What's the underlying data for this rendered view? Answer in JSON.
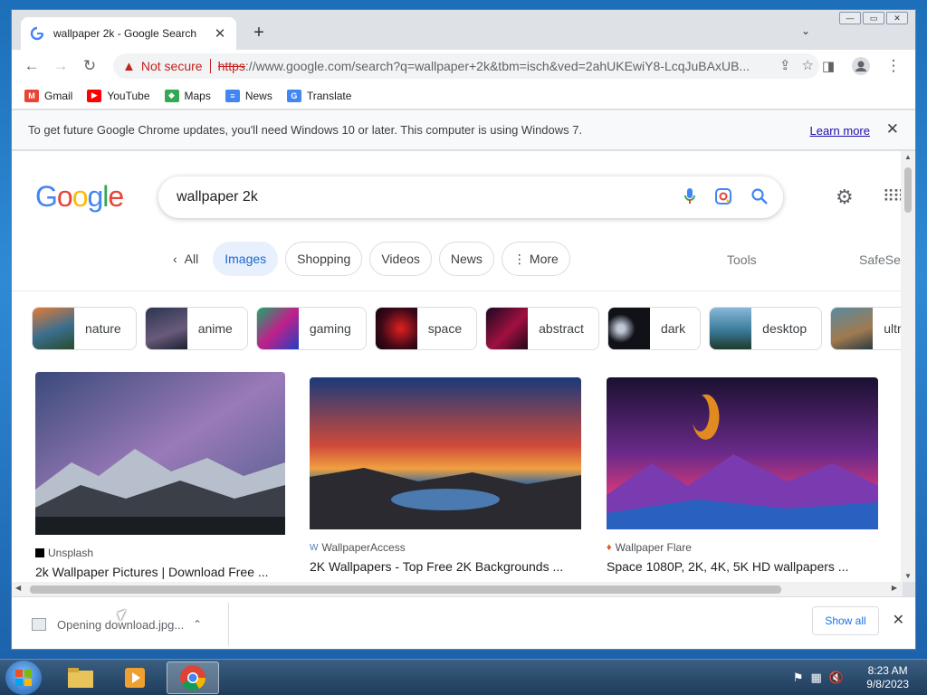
{
  "browser": {
    "tab_title": "wallpaper 2k - Google Search",
    "new_tab": "+",
    "not_secure": "Not secure",
    "url_scheme": "https",
    "url_rest": "://www.google.com/search?q=wallpaper+2k&tbm=isch&ved=2ahUKEwiY8-LcqJuBAxUB..."
  },
  "bookmarks": [
    {
      "label": "Gmail",
      "icon": "gmail-icon",
      "color": "#ea4335"
    },
    {
      "label": "YouTube",
      "icon": "youtube-icon",
      "color": "#ff0000"
    },
    {
      "label": "Maps",
      "icon": "maps-icon",
      "color": "#34a853"
    },
    {
      "label": "News",
      "icon": "news-icon",
      "color": "#4285f4"
    },
    {
      "label": "Translate",
      "icon": "translate-icon",
      "color": "#4285f4"
    }
  ],
  "infobar": {
    "text": "To get future Google Chrome updates, you'll need Windows 10 or later. This computer is using Windows 7.",
    "learn_more": "Learn more"
  },
  "search": {
    "query": "wallpaper 2k"
  },
  "filters": [
    "All",
    "Images",
    "Shopping",
    "Videos",
    "News",
    "More"
  ],
  "active_filter": "Images",
  "tools": "Tools",
  "safesearch": "SafeSe",
  "related": [
    "nature",
    "anime",
    "gaming",
    "space",
    "abstract",
    "dark",
    "desktop",
    "ultra"
  ],
  "results": [
    {
      "source": "Unsplash",
      "title": "2k Wallpaper Pictures | Download Free ..."
    },
    {
      "source": "WallpaperAccess",
      "title": "2K Wallpapers - Top Free 2K Backgrounds ..."
    },
    {
      "source": "Wallpaper Flare",
      "title": "Space 1080P, 2K, 4K, 5K HD wallpapers ..."
    }
  ],
  "downloads": {
    "item": "Opening download.jpg...",
    "show_all": "Show all"
  },
  "taskbar": {
    "time": "8:23 AM",
    "date": "9/8/2023"
  }
}
